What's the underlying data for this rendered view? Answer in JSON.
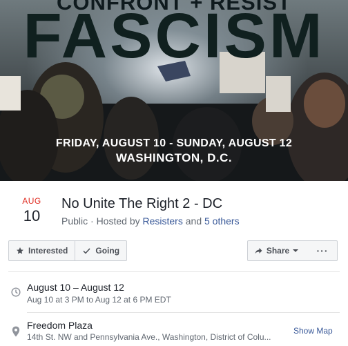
{
  "cover": {
    "top_line": "CONFRONT + RESIST",
    "headline": "FASCISM",
    "dates": "FRIDAY, AUGUST 10 - SUNDAY, AUGUST 12",
    "place": "WASHINGTON, D.C."
  },
  "event": {
    "month": "AUG",
    "day": "10",
    "title": "No Unite The Right 2 - DC",
    "visibility": "Public · Hosted by ",
    "host": "Resisters",
    "and_text": " and ",
    "others": "5 others"
  },
  "actions": {
    "interested": "Interested",
    "going": "Going",
    "share": "Share",
    "more": "···"
  },
  "details": {
    "date_main": "August 10 – August 12",
    "date_sub": "Aug 10 at 3 PM to Aug 12 at 6 PM EDT",
    "location_name": "Freedom Plaza",
    "location_address": "14th St. NW and Pennsylvania Ave., Washington, District of Colu...",
    "show_map": "Show Map"
  },
  "colors": {
    "month_red": "#e02a1f",
    "link_blue": "#385898"
  },
  "icons": [
    "star-icon",
    "check-icon",
    "share-arrow-icon",
    "caret-down-icon",
    "clock-icon",
    "map-pin-icon"
  ]
}
